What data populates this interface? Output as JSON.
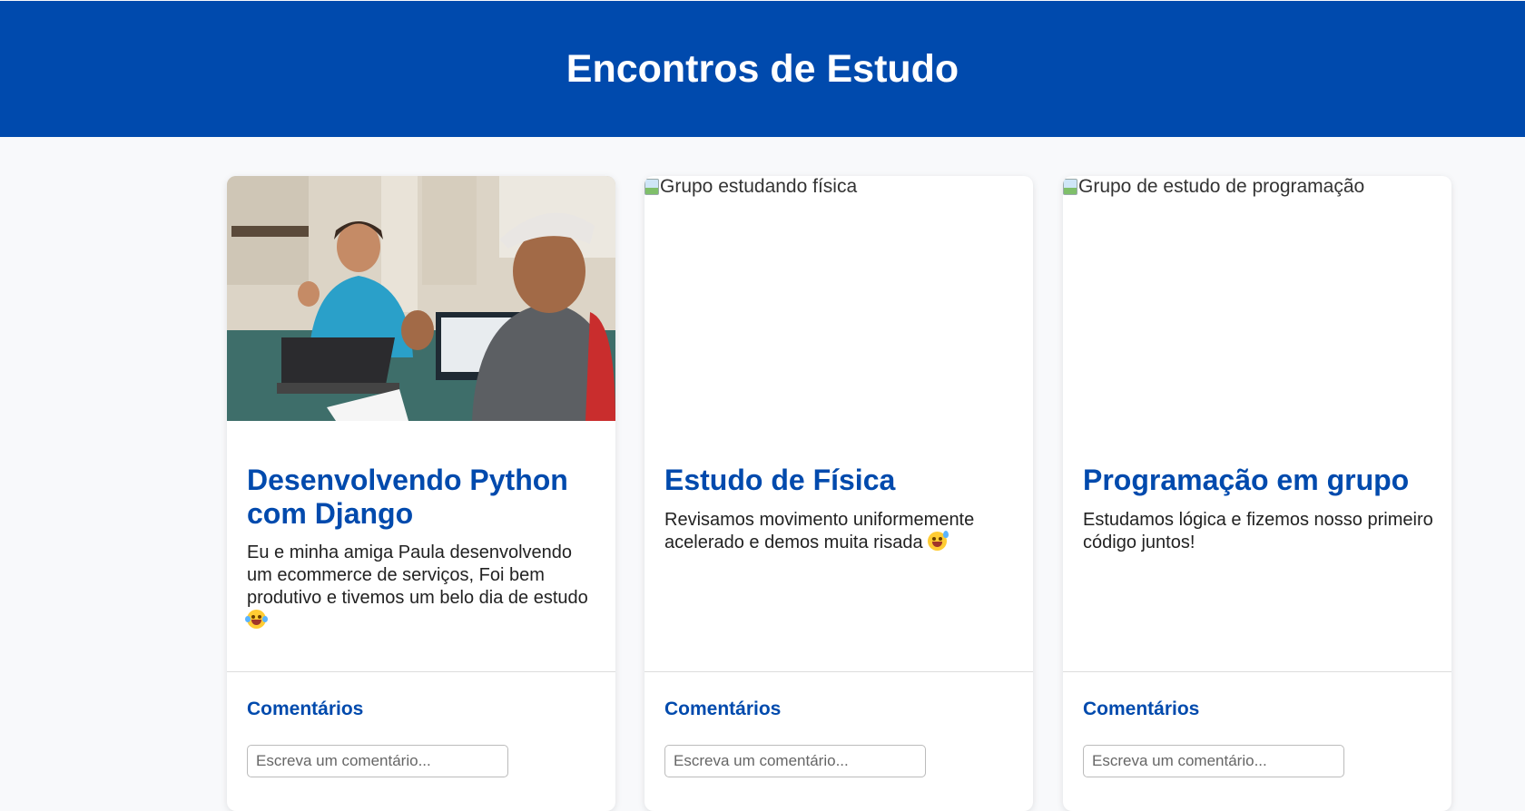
{
  "header": {
    "title": "Encontros de Estudo"
  },
  "colors": {
    "primary": "#004aad",
    "background": "#f8f9fb"
  },
  "cards": [
    {
      "image_alt": "",
      "title": "Desenvolvendo Python com Django",
      "text": "Eu e minha amiga Paula desenvolvendo um ecommerce de serviços, Foi bem produtivo e tivemos um belo dia de estudo",
      "emoji": "tears-of-joy-icon",
      "comments_title": "Comentários",
      "comment_placeholder": "Escreva um comentário..."
    },
    {
      "image_alt": "Grupo estudando física",
      "title": "Estudo de Física",
      "text": "Revisamos movimento uniformemente acelerado e demos muita risada",
      "emoji": "grinning-sweat-icon",
      "comments_title": "Comentários",
      "comment_placeholder": "Escreva um comentário..."
    },
    {
      "image_alt": "Grupo de estudo de programação",
      "title": "Programação em grupo",
      "text": "Estudamos lógica e fizemos nosso primeiro código juntos!",
      "comments_title": "Comentários",
      "comment_placeholder": "Escreva um comentário..."
    }
  ]
}
